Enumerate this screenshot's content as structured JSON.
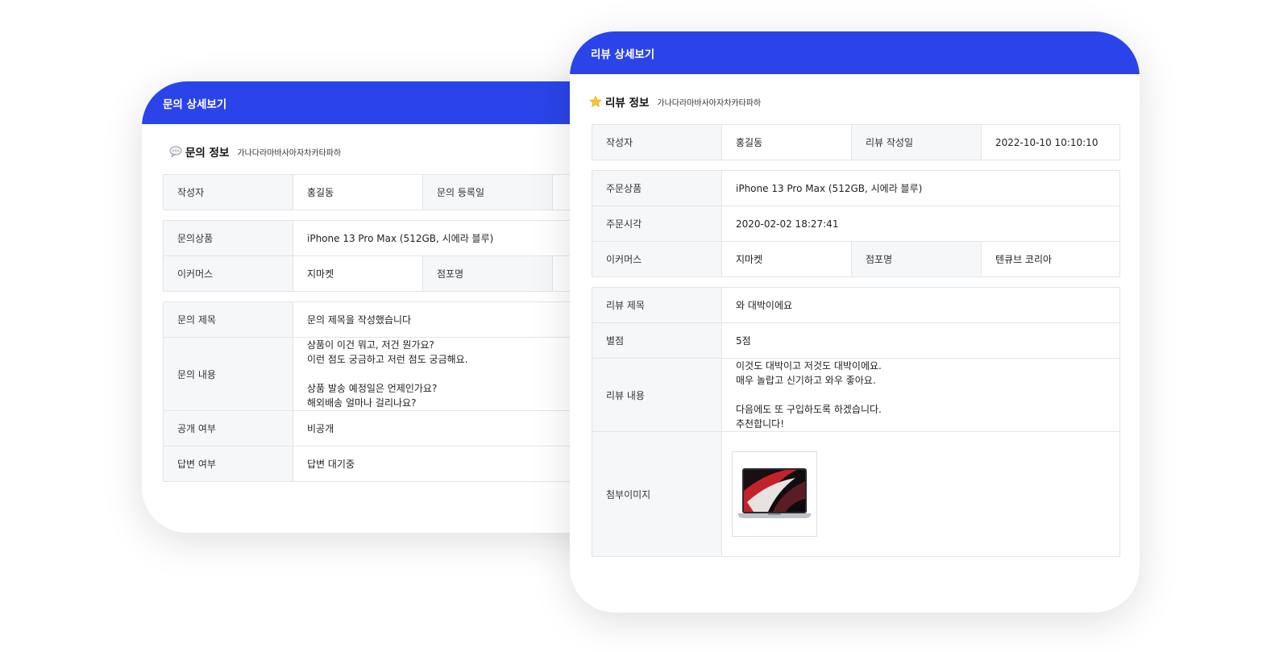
{
  "inquiry": {
    "header": "문의 상세보기",
    "section_title": "문의 정보",
    "section_sub": "가나다라마바사아자차카타파하",
    "author_label": "작성자",
    "author_value": "홍길동",
    "date_label": "문의 등록일",
    "product_label": "문의상품",
    "product_value": "iPhone 13 Pro Max (512GB, 시에라 블루)",
    "ecommerce_label": "이커머스",
    "ecommerce_value": "지마켓",
    "store_label": "점포명",
    "subject_label": "문의 제목",
    "subject_value": "문의 제목을 작성했습니다",
    "content_label": "문의 내용",
    "content_lines": [
      "상품이 이건 뭐고, 저건 뭔가요?",
      "이런 점도 궁금하고 저런 점도 궁금해요.",
      "",
      "상품 발송 예정일은 언제인가요?",
      "해외배송 얼마나 걸리나요?"
    ],
    "public_label": "공개 여부",
    "public_value": "비공개",
    "answer_label": "답변 여부",
    "answer_value": "답변 대기중"
  },
  "review": {
    "header": "리뷰 상세보기",
    "section_title": "리뷰 정보",
    "section_sub": "가나다라마바사아자차카타파하",
    "author_label": "작성자",
    "author_value": "홍길동",
    "date_label": "리뷰 작성일",
    "date_value": "2022-10-10 10:10:10",
    "product_label": "주문상품",
    "product_value": "iPhone 13 Pro Max (512GB, 시에라 블루)",
    "order_time_label": "주문시각",
    "order_time_value": "2020-02-02 18:27:41",
    "ecommerce_label": "이커머스",
    "ecommerce_value": "지마켓",
    "store_label": "점포명",
    "store_value": "텐큐브 코리아",
    "subject_label": "리뷰 제목",
    "subject_value": "와 대박이에요",
    "rating_label": "별점",
    "rating_value": "5점",
    "content_label": "리뷰 내용",
    "content_lines": [
      "이것도 대박이고 저것도 대박이에요.",
      "매우 놀랍고 신기하고 와우 좋아요.",
      "",
      "다음에도 또 구입하도록 하겠습니다.",
      "추천합니다!"
    ],
    "attachment_label": "첨부이미지"
  },
  "colors": {
    "accent": "#2a44e9",
    "label_bg": "#f6f7f9",
    "border": "#e2e5ea"
  }
}
